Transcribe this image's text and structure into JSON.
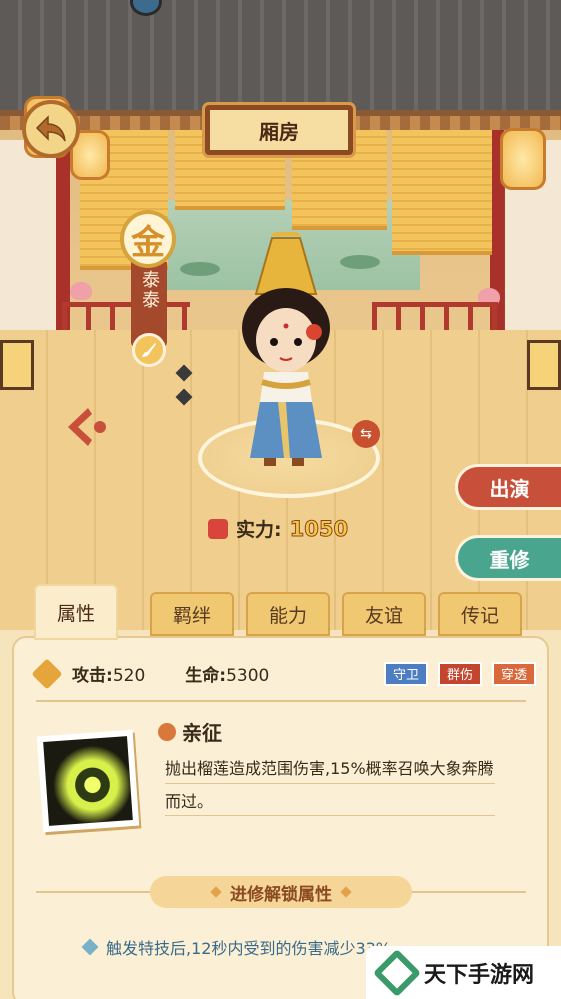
{
  "header": {
    "title": "厢房",
    "back_icon": "back-arrow-icon"
  },
  "character": {
    "rank": "金",
    "name": "泰泰",
    "power_label": "实力:",
    "power_value": "1050"
  },
  "side_buttons": {
    "perform": "出演",
    "retrain": "重修"
  },
  "tabs": [
    {
      "label": "属性",
      "active": true
    },
    {
      "label": "羁绊"
    },
    {
      "label": "能力"
    },
    {
      "label": "友谊"
    },
    {
      "label": "传记"
    }
  ],
  "stats": {
    "attack_label": "攻击:",
    "attack_value": "520",
    "hp_label": "生命:",
    "hp_value": "5300",
    "tags": [
      "守卫",
      "群伤",
      "穿透"
    ]
  },
  "skill": {
    "name": "亲征",
    "description": "抛出榴莲造成范围伤害,15%概率召唤大象奔腾而过。"
  },
  "unlock": {
    "title": "进修解锁属性",
    "item": "触发特技后,12秒内受到的伤害减少33%"
  },
  "watermark": {
    "text": "天下手游网"
  },
  "colors": {
    "accent": "#c8503a",
    "teal": "#4aa58f",
    "gold": "#f7c64a"
  }
}
